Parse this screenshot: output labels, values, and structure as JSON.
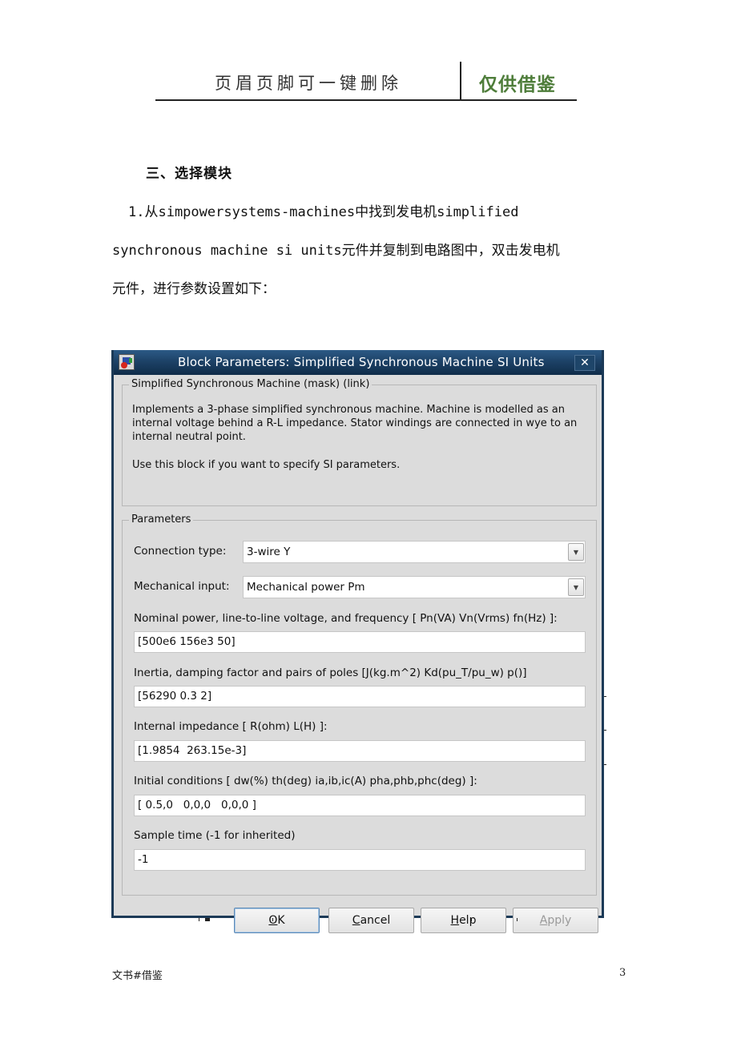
{
  "page_header": {
    "left_text": "页眉页脚可一键删除",
    "right_text": "仅供借鉴",
    "right_color": "#4e7d3a"
  },
  "section": {
    "title": "三、选择模块",
    "paragraph_lines": [
      "1.从simpowersystems-machines中找到发电机simplified",
      "synchronous machine si units元件并复制到电路图中，双击发电机",
      "元件，进行参数设置如下："
    ]
  },
  "dialog": {
    "title": "Block Parameters: Simplified Synchronous Machine SI Units",
    "app_icon": "simulink-block-icon",
    "close_icon": "close-icon",
    "close_label": "✕",
    "mask_group": {
      "label": "Simplified Synchronous Machine (mask) (link)",
      "description": "Implements a 3-phase simplified synchronous machine. Machine is modelled as an internal voltage behind a R-L impedance. Stator windings are connected in wye to an internal neutral point.",
      "note": "Use this block if you want to specify SI  parameters."
    },
    "parameters_group": {
      "label": "Parameters",
      "connection_type": {
        "label": "Connection type:",
        "value": "3-wire Y"
      },
      "mechanical_input": {
        "label": "Mechanical input:",
        "value": "Mechanical power Pm"
      },
      "fields": [
        {
          "label": "Nominal power, line-to-line voltage, and frequency [ Pn(VA) Vn(Vrms) fn(Hz) ]:",
          "value": "[500e6 156e3 50]"
        },
        {
          "label": "Inertia, damping factor and pairs of poles [J(kg.m^2) Kd(pu_T/pu_w) p()]",
          "value": "[56290 0.3 2]"
        },
        {
          "label": "Internal impedance [ R(ohm)  L(H) ]:",
          "value": "[1.9854  263.15e-3]"
        },
        {
          "label": "Initial conditions [ dw(%)  th(deg)  ia,ib,ic(A)  pha,phb,phc(deg) ]:",
          "value": "[ 0.5,0   0,0,0   0,0,0 ]"
        },
        {
          "label": "Sample time (-1 for inherited)",
          "value": "-1"
        }
      ],
      "dropdown_arrow_icon": "chevron-down-icon"
    },
    "buttons": {
      "ok": {
        "mnemonic": "O",
        "rest": "K"
      },
      "cancel": {
        "mnemonic": "C",
        "rest": "ancel"
      },
      "help": {
        "mnemonic": "H",
        "rest": "elp"
      },
      "apply": {
        "mnemonic": "A",
        "rest": "pply",
        "disabled": true
      }
    }
  },
  "footer": {
    "left_text": "文书#借鉴",
    "page_number": "3"
  }
}
